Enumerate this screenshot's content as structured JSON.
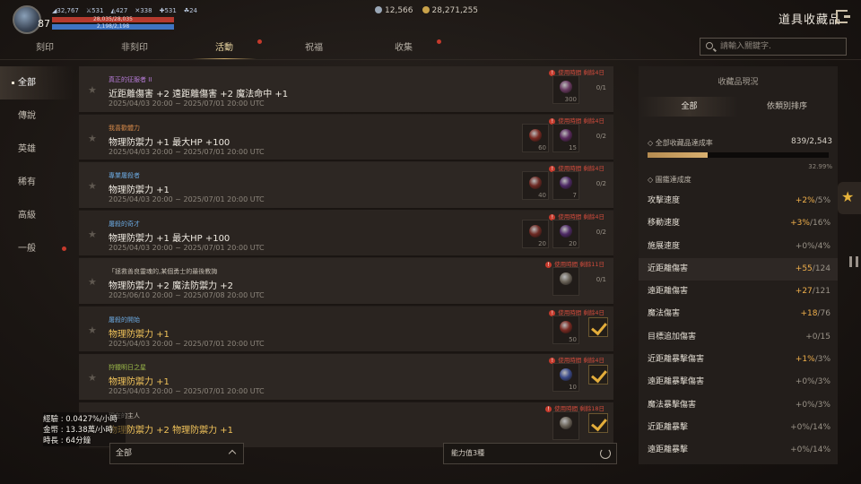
{
  "player": {
    "level": "87",
    "stats": [
      "32,767",
      "531",
      "427",
      "338",
      "531",
      "24"
    ],
    "hp_text": "28,035/28,035",
    "mp_text": "2,198/2,198",
    "hp_pct": 1.0,
    "mp_pct": 1.0
  },
  "currency": [
    {
      "icon": "diamond-icon",
      "value": "12,566",
      "color": "#9aa7b6"
    },
    {
      "icon": "gold-coin-icon",
      "value": "28,271,255",
      "color": "#c9a24a"
    }
  ],
  "title": "道具收藏品",
  "tabs": [
    {
      "label": "刻印",
      "dot": false
    },
    {
      "label": "非刻印",
      "dot": false
    },
    {
      "label": "活動",
      "dot": true,
      "active": true
    },
    {
      "label": "祝福",
      "dot": false
    },
    {
      "label": "收集",
      "dot": true
    }
  ],
  "search": {
    "placeholder": "請輸入關鍵字."
  },
  "sidebar": [
    {
      "label": "全部",
      "active": true
    },
    {
      "label": "傳說"
    },
    {
      "label": "英雄"
    },
    {
      "label": "稀有"
    },
    {
      "label": "高級"
    },
    {
      "label": "一般",
      "dot": true
    }
  ],
  "rows": [
    {
      "category": "真正的征服者 II",
      "cat_color": "#b77cd8",
      "stat": "近距離傷害 +2 遠距離傷害 +2 魔法命中 +1",
      "date": "2025/04/03 20:00 ~ 2025/07/01 20:00 UTC",
      "warn": "使用時間 剩餘4日",
      "slots": [
        {
          "count": "300",
          "color": "#6a3a62"
        }
      ],
      "progress": "0/1",
      "done": false
    },
    {
      "category": "我喜歡體力",
      "cat_color": "#d68a4a",
      "stat": "物理防禦力 +1 最大HP +100",
      "date": "2025/04/03 20:00 ~ 2025/07/01 20:00 UTC",
      "warn": "使用時間 剩餘4日",
      "slots": [
        {
          "count": "60",
          "color": "#7a2a22"
        },
        {
          "count": "15",
          "color": "#5a2a5e"
        }
      ],
      "progress": "0/2",
      "done": false
    },
    {
      "category": "專業屠殺者",
      "cat_color": "#6aa6dc",
      "stat": "物理防禦力 +1",
      "date": "2025/04/03 20:00 ~ 2025/07/01 20:00 UTC",
      "warn": "使用時間 剩餘4日",
      "slots": [
        {
          "count": "40",
          "color": "#6e2a24"
        },
        {
          "count": "7",
          "color": "#4e2a66"
        }
      ],
      "progress": "0/2",
      "done": false
    },
    {
      "category": "屠殺的奇才",
      "cat_color": "#6aa6dc",
      "stat": "物理防禦力 +1 最大HP +100",
      "date": "2025/04/03 20:00 ~ 2025/07/01 20:00 UTC",
      "warn": "使用時間 剩餘4日",
      "slots": [
        {
          "count": "20",
          "color": "#6e2a24"
        },
        {
          "count": "20",
          "color": "#4e2a66"
        }
      ],
      "progress": "0/2",
      "done": false
    },
    {
      "category": "「拯救善良靈魂的,某個勇士的最後教誨",
      "cat_color": "#c4bdb2",
      "stat": "物理防禦力 +2 魔法防禦力 +2",
      "date": "2025/06/10 20:00 ~ 2025/07/08 20:00 UTC",
      "warn": "使用時間 剩餘11日",
      "slots": [
        {
          "count": "",
          "color": "#6a6358"
        }
      ],
      "progress": "0/1",
      "done": false
    },
    {
      "category": "屠殺的開始",
      "cat_color": "#6aa6dc",
      "stat": "物理防禦力 +1",
      "stat_color": "#f1c35a",
      "date": "2025/04/03 20:00 ~ 2025/07/01 20:00 UTC",
      "warn": "使用時間 剩餘4日",
      "slots": [
        {
          "count": "50",
          "color": "#7a2a22"
        }
      ],
      "progress": "",
      "done": true
    },
    {
      "category": "狩獵明日之星",
      "cat_color": "#9dbb4a",
      "stat": "物理防禦力 +1",
      "stat_color": "#f1c35a",
      "date": "2025/04/03 20:00 ~ 2025/07/01 20:00 UTC",
      "warn": "使用時間 剩餘4日",
      "slots": [
        {
          "count": "10",
          "color": "#3a4a8a"
        }
      ],
      "progress": "",
      "done": true
    },
    {
      "category": "現在的主人",
      "cat_color": "#c4bdb2",
      "stat": "物理防禦力 +2 物理防禦力 +1",
      "stat_color": "#f1c35a",
      "date": "",
      "warn": "使用時間 剩餘18日",
      "slots": [
        {
          "count": "",
          "color": "#6a6358"
        }
      ],
      "progress": "",
      "done": true
    }
  ],
  "bottom": {
    "filter": "全部",
    "sort": "能力值3種"
  },
  "exp": {
    "line1": "經驗 : 0.0427%/小時",
    "line2": "金幣 : 13.38萬/小時",
    "line3": "時長 : 64分鐘"
  },
  "panel": {
    "title": "收藏品現況",
    "tabs": [
      "全部",
      "依類別排序"
    ],
    "total_label": "◇ 全部收藏品達成率",
    "total_value": "839/2,543",
    "total_pct": "32.99%",
    "total_fraction": 0.3299,
    "section_label": "◇ 圖鑑達成度",
    "rows": [
      {
        "name": "攻擊速度",
        "gain": "+2%",
        "max": "/5%",
        "hl": false
      },
      {
        "name": "移動速度",
        "gain": "+3%",
        "max": "/16%",
        "hl": false
      },
      {
        "name": "施展速度",
        "gain": "",
        "max": "+0%/4%",
        "hl": false
      },
      {
        "name": "近距離傷害",
        "gain": "+55",
        "max": "/124",
        "hl": true
      },
      {
        "name": "遠距離傷害",
        "gain": "+27",
        "max": "/121",
        "hl": false
      },
      {
        "name": "魔法傷害",
        "gain": "+18",
        "max": "/76",
        "hl": false
      },
      {
        "name": "目標追加傷害",
        "gain": "",
        "max": "+0/15",
        "hl": false
      },
      {
        "name": "近距離暴擊傷害",
        "gain": "+1%",
        "max": "/3%",
        "hl": false
      },
      {
        "name": "遠距離暴擊傷害",
        "gain": "",
        "max": "+0%/3%",
        "hl": false
      },
      {
        "name": "魔法暴擊傷害",
        "gain": "",
        "max": "+0%/3%",
        "hl": false
      },
      {
        "name": "近距離暴擊",
        "gain": "",
        "max": "+0%/14%",
        "hl": false
      },
      {
        "name": "遠距離暴擊",
        "gain": "",
        "max": "+0%/14%",
        "hl": false
      }
    ]
  }
}
